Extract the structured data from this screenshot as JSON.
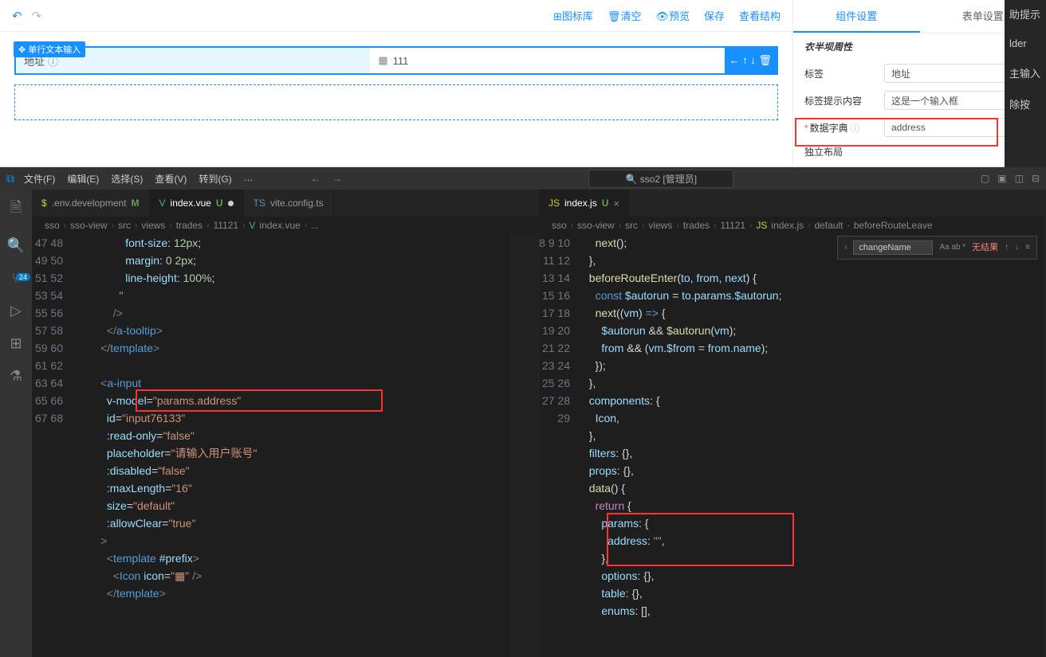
{
  "designer": {
    "toolbar": {
      "icon_lib": "⊞图标库",
      "clear": "🗑清空",
      "preview": "👁预览",
      "save": "保存",
      "view_struct": "查看结构"
    },
    "badge": "✥ 单行文本输入",
    "cell1_label": "地址",
    "cell2_label": "111",
    "row_actions": "← ↑ ↓ 🗑"
  },
  "props": {
    "tab1": "组件设置",
    "tab2": "表单设置",
    "section": "衣半坝周性",
    "chev": "⌄",
    "label_field": "标签",
    "label_value": "地址",
    "hint_field": "标签提示内容",
    "hint_value": "这是一个输入框",
    "dict_field": "数据字典",
    "dict_value": "address",
    "indep_field": "独立布局"
  },
  "dark_strip": {
    "t1": "助提示",
    "t2": "lder",
    "t3": "主输入",
    "t4": "除按"
  },
  "vscode": {
    "menu": {
      "file": "文件(F)",
      "edit": "编辑(E)",
      "select": "选择(S)",
      "view": "查看(V)",
      "goto": "转到(G)",
      "more": "…"
    },
    "nav": {
      "back": "←",
      "fwd": "→"
    },
    "search_text": "sso2 [管理员]",
    "activity_badge": "24",
    "left_pane": {
      "tabs": [
        {
          "icon": "$",
          "name": ".env.development",
          "mod": "M"
        },
        {
          "icon": "V",
          "name": "index.vue",
          "mod": "U"
        },
        {
          "icon": "TS",
          "name": "vite.config.ts",
          "mod": ""
        }
      ],
      "crumbs": [
        "sso",
        "sso-view",
        "src",
        "views",
        "trades",
        "11121",
        "index.vue",
        "..."
      ],
      "lines_start": 47,
      "lines_end": 68
    },
    "right_pane": {
      "tabs": [
        {
          "icon": "JS",
          "name": "index.js",
          "mod": "U"
        }
      ],
      "crumbs": [
        "sso",
        "sso-view",
        "src",
        "views",
        "trades",
        "11121",
        "index.js",
        "default",
        "beforeRouteLeave"
      ],
      "find": {
        "query": "changeName",
        "opts": "Aa ab *",
        "result": "无结果"
      },
      "lines_start": 8,
      "lines_end": 29
    }
  }
}
